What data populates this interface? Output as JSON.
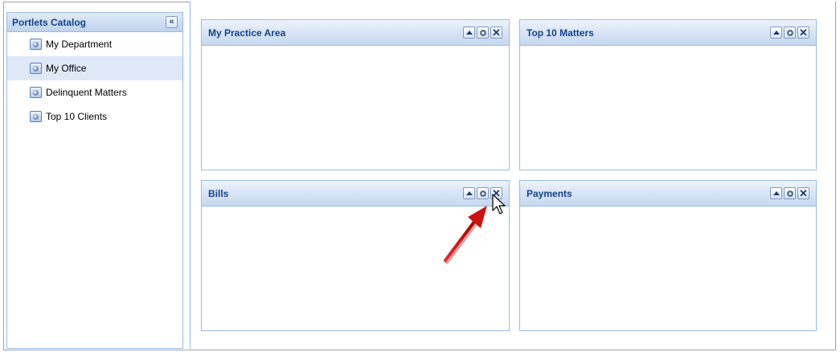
{
  "sidebar": {
    "title": "Portlets Catalog",
    "collapse_icon": "«",
    "items": [
      {
        "label": "My Department",
        "selected": false
      },
      {
        "label": "My Office",
        "selected": true
      },
      {
        "label": "Delinquent Matters",
        "selected": false
      },
      {
        "label": "Top 10 Clients",
        "selected": false
      }
    ]
  },
  "portlets": [
    {
      "title": "My Practice Area"
    },
    {
      "title": "Top 10 Matters"
    },
    {
      "title": "Bills"
    },
    {
      "title": "Payments"
    }
  ],
  "tools": {
    "collapse": "triangle-up-icon",
    "settings": "gear-icon",
    "close": "close-icon",
    "close_glyph": "✕"
  },
  "colors": {
    "header_title": "#15428b",
    "panel_border": "#99bbe8",
    "selected_row": "#dfe8f6",
    "annotation_arrow": "#cc1111"
  }
}
